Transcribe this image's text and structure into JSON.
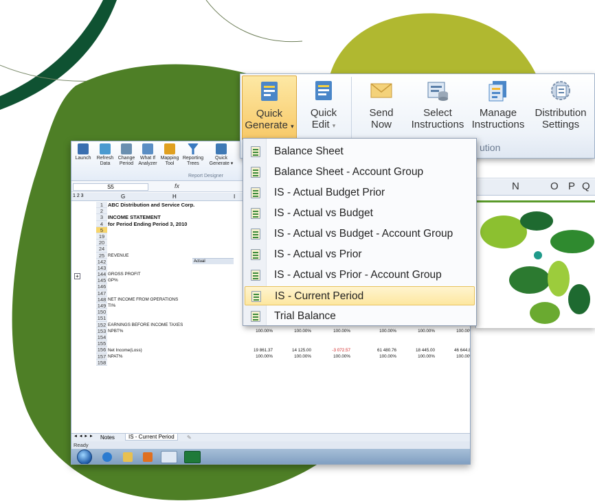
{
  "front_ribbon": {
    "buttons": [
      {
        "line1": "Quick",
        "line2": "Generate",
        "caret": "▾",
        "icon": "quick-generate-icon",
        "active": true
      },
      {
        "line1": "Quick",
        "line2": "Edit",
        "caret": "▾",
        "icon": "quick-edit-icon"
      },
      {
        "line1": "Send",
        "line2": "Now",
        "icon": "envelope-icon"
      },
      {
        "line1": "Select",
        "line2": "Instructions",
        "icon": "select-instructions-icon"
      },
      {
        "line1": "Manage",
        "line2": "Instructions",
        "icon": "manage-instructions-icon"
      },
      {
        "line1": "Distribution",
        "line2": "Settings",
        "icon": "distribution-settings-icon"
      }
    ],
    "group_label": "ution"
  },
  "dropdown": {
    "items": [
      "Balance Sheet",
      "Balance Sheet - Account Group",
      "IS - Actual Budget Prior",
      "IS - Actual vs Budget",
      "IS - Actual vs Budget - Account Group",
      "IS - Actual vs Prior",
      "IS - Actual vs Prior - Account Group",
      "IS - Current Period",
      "Trial Balance"
    ],
    "highlighted_index": 7
  },
  "right_strip": {
    "columns": [
      "N",
      "O",
      "P",
      "Q"
    ]
  },
  "excel": {
    "ribbon_buttons": [
      {
        "line1": "Launch",
        "line2": ""
      },
      {
        "line1": "Refresh",
        "line2": "Data"
      },
      {
        "line1": "Change",
        "line2": "Period"
      },
      {
        "line1": "What If",
        "line2": "Analyzer"
      },
      {
        "line1": "Mapping",
        "line2": "Tool"
      },
      {
        "line1": "Reporting",
        "line2": "Trees"
      },
      {
        "line1": "Quick",
        "line2": "Generate ▾"
      }
    ],
    "group_label": "Report Designer",
    "name_box": "S5",
    "fx": "fx",
    "outline_levels": "1 2 3",
    "col_headers": [
      "G",
      "H",
      "I"
    ],
    "actual_header": "Actual",
    "title_rows": [
      {
        "num": "1",
        "text": "ABC Distribution and Service Corp."
      },
      {
        "num": "2",
        "text": ""
      },
      {
        "num": "3",
        "text": "INCOME STATEMENT"
      },
      {
        "num": "4",
        "text": "for Period Ending Period 3, 2010"
      },
      {
        "num": "5",
        "text": ""
      },
      {
        "num": "19",
        "text": ""
      },
      {
        "num": "20",
        "text": ""
      }
    ],
    "data_rows": [
      {
        "num": "24",
        "label": "",
        "v": []
      },
      {
        "num": "25",
        "label": "REVENUE",
        "v": [
          "19 8"
        ]
      },
      {
        "num": "142",
        "label": "",
        "v": []
      },
      {
        "num": "143",
        "label": "",
        "v": []
      },
      {
        "num": "144",
        "label": "GROSS PROFIT",
        "v": [
          "19 8"
        ]
      },
      {
        "num": "145",
        "label": "GP%",
        "v": [
          "100"
        ]
      },
      {
        "num": "146",
        "label": "",
        "v": []
      },
      {
        "num": "147",
        "label": "",
        "v": []
      },
      {
        "num": "148",
        "label": "NET INCOME FROM OPERATIONS",
        "v": [
          "19 861.37",
          "14 125.00",
          "-3 072.57",
          "61 480.76",
          "18 445.00",
          "46 644.87"
        ]
      },
      {
        "num": "149",
        "label": "TI%",
        "v": [
          "100.00%",
          "100.00%",
          "100.00%",
          "100.00%",
          "100.00%",
          "100.00%"
        ]
      },
      {
        "num": "150",
        "label": "",
        "v": []
      },
      {
        "num": "151",
        "label": "",
        "v": []
      },
      {
        "num": "152",
        "label": "EARNINGS BEFORE INCOME TAXES",
        "v": [
          "19 861.37",
          "14 125.00",
          "-3 072.57",
          "61 480.76",
          "18 445.00",
          "46 644.87"
        ]
      },
      {
        "num": "153",
        "label": "NPBT%",
        "v": [
          "100.00%",
          "100.00%",
          "100.00%",
          "100.00%",
          "100.00%",
          "100.00%"
        ]
      },
      {
        "num": "154",
        "label": "",
        "v": []
      },
      {
        "num": "155",
        "label": "",
        "v": []
      },
      {
        "num": "156",
        "label": "Net Income(Loss)",
        "v": [
          "19 861.37",
          "14 125.00",
          "-3 072.57",
          "61 480.76",
          "18 445.00",
          "46 644.87"
        ]
      },
      {
        "num": "157",
        "label": "NPAT%",
        "v": [
          "100.00%",
          "100.00%",
          "100.00%",
          "100.00%",
          "100.00%",
          "100.00%"
        ]
      },
      {
        "num": "158",
        "label": "",
        "v": []
      }
    ],
    "sheet_tabs": {
      "nav": "◄ ◄ ► ►",
      "tab1": "Notes",
      "tab2": "IS - Current Period",
      "tab3": "✎"
    },
    "status": "Ready",
    "colors": {
      "negative": "#d02020",
      "selected_row": "#f7d56b"
    }
  },
  "colors": {
    "bg_dark_green": "#4e7f26",
    "bg_lime": "#b0b830",
    "bg_deep": "#0f5232",
    "highlight": "#fde7a0"
  }
}
